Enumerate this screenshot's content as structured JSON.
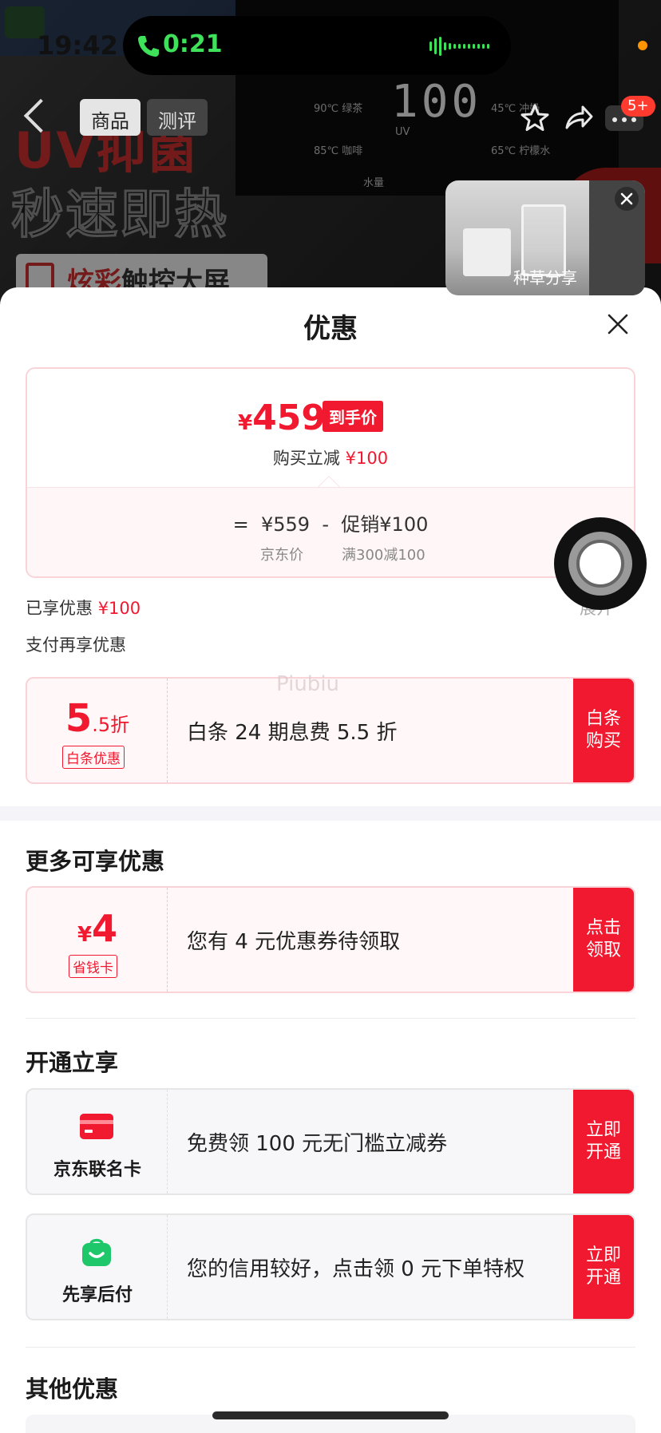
{
  "status_bar": {
    "time": "19:42",
    "call_duration": "0:21"
  },
  "background_page": {
    "headline_1": "UV抑菌",
    "headline_2": "秒速即热",
    "headline_3_red": "炫彩",
    "headline_3_rest": "触控大屏",
    "display_digits": "100",
    "panel_labels": [
      "90℃ 绿茶",
      "85℃ 咖啡",
      "45℃ 冲奶",
      "65℃ 柠檬水",
      "水量",
      "UV"
    ],
    "tabs": {
      "product": "商品",
      "review": "测评"
    },
    "cart_badge": "5+"
  },
  "video_popup": {
    "label": "种草分享"
  },
  "sheet": {
    "title": "优惠",
    "price": {
      "currency": "¥",
      "final": "459",
      "final_tag": "到手价",
      "reduce_label": "购买立减",
      "reduce_amount": "¥100",
      "formula_eq": "=",
      "jd_price": "¥559",
      "formula_minus": "-",
      "promo": "促销¥100",
      "jd_price_label": "京东价",
      "promo_label": "满300减100"
    },
    "enjoyed_label": "已享优惠",
    "enjoyed_amount": "¥100",
    "expand_label": "展开",
    "pay_more_label": "支付再享优惠",
    "watermark": "Piubiu",
    "baitiao": {
      "big": "5",
      "small": ".5折",
      "tag": "白条优惠",
      "desc": "白条 24 期息费 5.5 折",
      "button": "白条购买"
    },
    "more_title": "更多可享优惠",
    "coupon": {
      "currency": "¥",
      "amount": "4",
      "tag": "省钱卡",
      "desc": "您有 4 元优惠券待领取",
      "button": "点击领取"
    },
    "open_title": "开通立享",
    "cobrand": {
      "name": "京东联名卡",
      "desc": "免费领 100 元无门槛立减券",
      "button": "立即开通"
    },
    "paylater": {
      "name": "先享后付",
      "desc": "您的信用较好，点击领 0 元下单特权",
      "button": "立即开通"
    },
    "other_title": "其他优惠"
  },
  "colors": {
    "accent_red": "#f0192f",
    "call_green": "#3fe05a",
    "icon_green": "#1fc76b"
  }
}
